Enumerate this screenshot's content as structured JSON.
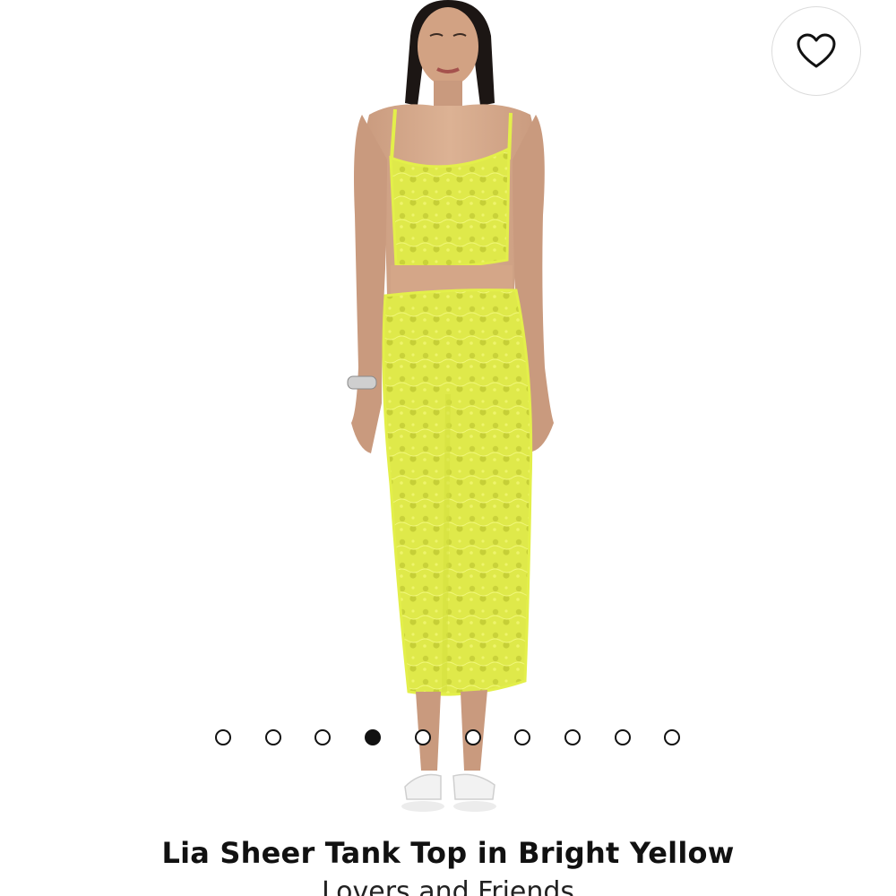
{
  "product": {
    "title": "Lia Sheer Tank Top in Bright Yellow",
    "brand": "Lovers and Friends",
    "garment_color": "#e3ef4a"
  },
  "wishlist": {
    "icon": "heart-outline-icon"
  },
  "carousel": {
    "total": 10,
    "active_index": 3
  }
}
